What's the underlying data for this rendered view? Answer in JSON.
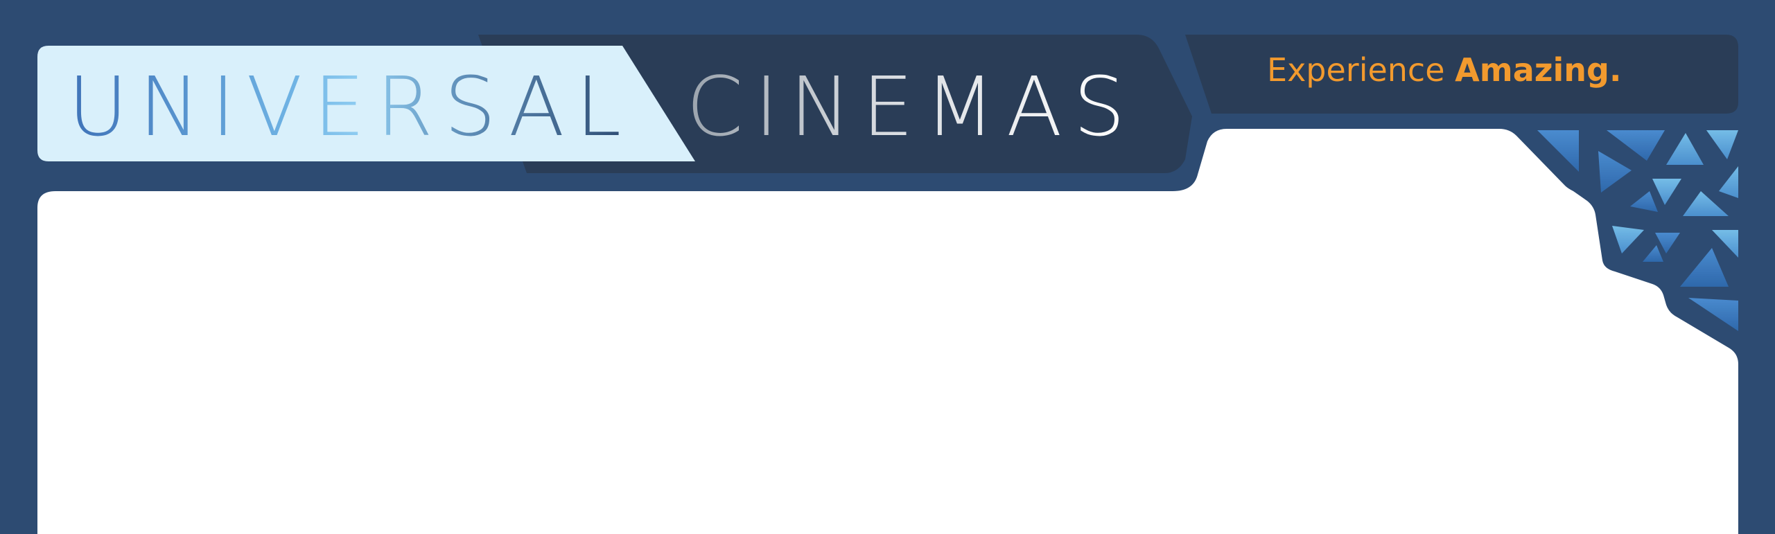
{
  "brand": {
    "name_part1": "UNIVERSAL",
    "name_part2": "CINEMAS",
    "tagline_light": "Experience ",
    "tagline_bold": "Amazing."
  },
  "colors": {
    "frame": "#2d4b72",
    "header_dark": "#2a3d57",
    "logo_panel": "#d9f0fb",
    "content": "#ffffff",
    "accent": "#f29a2e",
    "triangle_light": "#6db7e6",
    "triangle_dark": "#3f7fc4"
  },
  "decor": {
    "corner_pattern": "triangle-mosaic"
  }
}
